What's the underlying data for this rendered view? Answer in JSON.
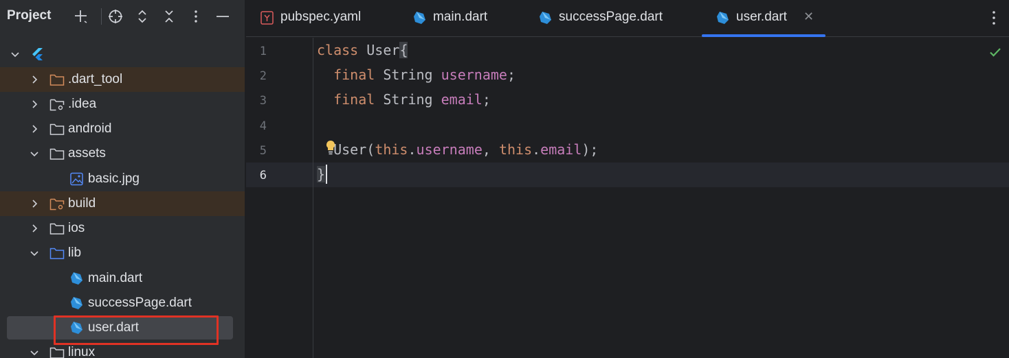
{
  "project_panel": {
    "title": "Project",
    "header_icons": [
      "add-icon",
      "locate-icon",
      "expand-all-icon",
      "collapse-all-icon",
      "more-vertical-icon",
      "minimize-icon"
    ],
    "tree": [
      {
        "label": "",
        "type": "flutter-root",
        "expanded": true
      },
      {
        "label": ".dart_tool",
        "type": "folder",
        "excluded": true
      },
      {
        "label": ".idea",
        "type": "folder-settings"
      },
      {
        "label": "android",
        "type": "folder"
      },
      {
        "label": "assets",
        "type": "folder",
        "expanded": true
      },
      {
        "label": "basic.jpg",
        "type": "image-file"
      },
      {
        "label": "build",
        "type": "folder-excluded",
        "excluded": true
      },
      {
        "label": "ios",
        "type": "folder"
      },
      {
        "label": "lib",
        "type": "folder-source",
        "expanded": true
      },
      {
        "label": "main.dart",
        "type": "dart-file"
      },
      {
        "label": "successPage.dart",
        "type": "dart-file"
      },
      {
        "label": "user.dart",
        "type": "dart-file",
        "selected": true
      },
      {
        "label": "linux",
        "type": "folder",
        "expanded": true
      }
    ]
  },
  "editor": {
    "tabs": [
      {
        "label": "pubspec.yaml",
        "icon": "yaml-icon"
      },
      {
        "label": "main.dart",
        "icon": "dart-icon"
      },
      {
        "label": "successPage.dart",
        "icon": "dart-icon"
      },
      {
        "label": "user.dart",
        "icon": "dart-icon",
        "active": true
      }
    ],
    "close_symbol": "✕",
    "line_numbers": [
      "1",
      "2",
      "3",
      "4",
      "5",
      "6"
    ],
    "code": {
      "l1_kw": "class",
      "l1_name": " User",
      "l1_brace": "{",
      "l2_indent": "  ",
      "l2_kw": "final",
      "l2_type": " String ",
      "l2_field": "username",
      "l2_end": ";",
      "l3_indent": "  ",
      "l3_kw": "final",
      "l3_type": " String ",
      "l3_field": "email",
      "l3_end": ";",
      "l5_indent": "  ",
      "l5_ctor": "User(",
      "l5_this1": "this",
      "l5_dot1": ".",
      "l5_f1": "username",
      "l5_sep": ", ",
      "l5_this2": "this",
      "l5_dot2": ".",
      "l5_f2": "email",
      "l5_end": ");",
      "l6_brace": "}"
    },
    "status": "check-icon"
  },
  "colors": {
    "keyword": "#cf8e6d",
    "field": "#c77dbb",
    "accent": "#3574f0",
    "highlight_box": "#e03224",
    "excluded_row": "#3b2f24"
  }
}
